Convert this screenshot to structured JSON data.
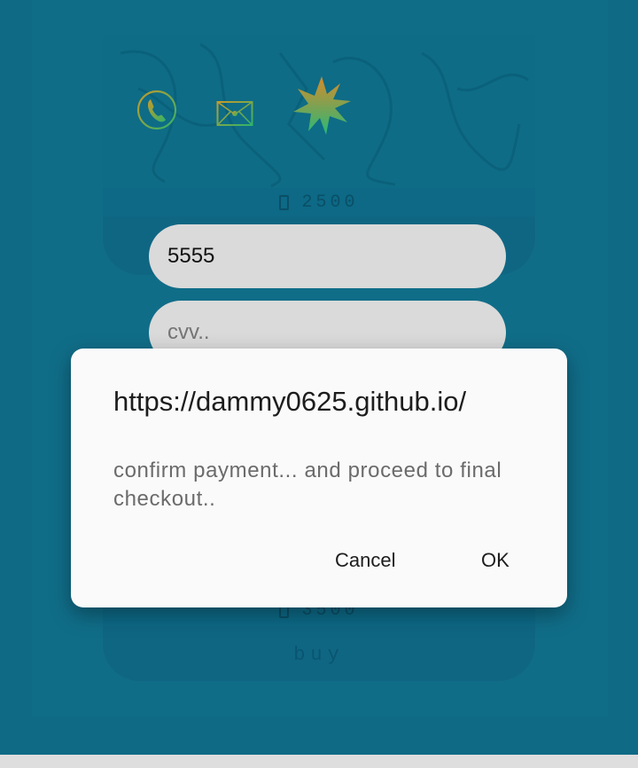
{
  "product": {
    "price_1": "2500",
    "price_2": "3500",
    "buy_label": "buy",
    "price_icon": "currency-glyph"
  },
  "icons": {
    "phone": "phone-icon",
    "mail": "envelope-icon",
    "star": "starburst-icon"
  },
  "form": {
    "card_number_value": "5555",
    "cvv_placeholder": "cvv.."
  },
  "dialog": {
    "title": "https://dammy0625.github.io/",
    "message": "confirm payment... and proceed to final checkout..",
    "cancel_label": "Cancel",
    "ok_label": "OK"
  },
  "colors": {
    "overlay_background": "#0e6a85",
    "dialog_background": "#fafafa",
    "icon_green": "#3aa35a",
    "star_orange": "#d88a2a"
  }
}
